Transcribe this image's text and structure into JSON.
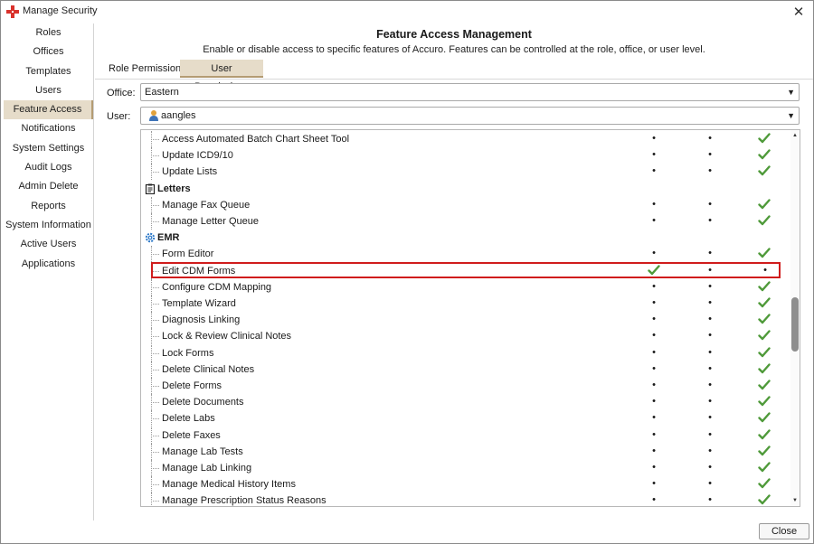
{
  "window": {
    "title": "Manage Security",
    "close_glyph": "✕"
  },
  "sidebar": {
    "items": [
      {
        "label": "Roles",
        "active": false
      },
      {
        "label": "Offices",
        "active": false
      },
      {
        "label": "Templates",
        "active": false
      },
      {
        "label": "Users",
        "active": false
      },
      {
        "label": "Feature Access",
        "active": true
      },
      {
        "label": "Notifications",
        "active": false
      },
      {
        "label": "System Settings",
        "active": false
      },
      {
        "label": "Audit Logs",
        "active": false
      },
      {
        "label": "Admin Delete",
        "active": false
      },
      {
        "label": "Reports",
        "active": false
      },
      {
        "label": "System Information",
        "active": false
      },
      {
        "label": "Active Users",
        "active": false
      },
      {
        "label": "Applications",
        "active": false
      }
    ]
  },
  "main": {
    "title": "Feature Access Management",
    "subtitle": "Enable or disable access to specific features of Accuro. Features can be controlled at the role, office, or user level.",
    "tabs": [
      {
        "label": "Role Permissions",
        "active": false
      },
      {
        "label": "User Permissions",
        "active": true
      }
    ],
    "office": {
      "label": "Office:",
      "value": "Eastern"
    },
    "user": {
      "label": "User:",
      "value": "aangles"
    }
  },
  "tree": {
    "rows": [
      {
        "type": "item",
        "label": "Access Automated Batch Chart Sheet Tool",
        "cells": [
          "dot",
          "dot",
          "check"
        ]
      },
      {
        "type": "item",
        "label": "Update ICD9/10",
        "cells": [
          "dot",
          "dot",
          "check"
        ]
      },
      {
        "type": "item",
        "label": "Update Lists",
        "cells": [
          "dot",
          "dot",
          "check"
        ]
      },
      {
        "type": "category",
        "label": "Letters",
        "icon": "clipboard-icon"
      },
      {
        "type": "item",
        "label": "Manage Fax Queue",
        "cells": [
          "dot",
          "dot",
          "check"
        ]
      },
      {
        "type": "item",
        "label": "Manage Letter Queue",
        "cells": [
          "dot",
          "dot",
          "check"
        ]
      },
      {
        "type": "category",
        "label": "EMR",
        "icon": "gear-icon"
      },
      {
        "type": "item",
        "label": "Form Editor",
        "cells": [
          "dot",
          "dot",
          "check"
        ]
      },
      {
        "type": "item",
        "label": "Edit CDM Forms",
        "cells": [
          "check",
          "dot",
          "dot"
        ],
        "highlight": true
      },
      {
        "type": "item",
        "label": "Configure CDM Mapping",
        "cells": [
          "dot",
          "dot",
          "check"
        ]
      },
      {
        "type": "item",
        "label": "Template Wizard",
        "cells": [
          "dot",
          "dot",
          "check"
        ]
      },
      {
        "type": "item",
        "label": "Diagnosis Linking",
        "cells": [
          "dot",
          "dot",
          "check"
        ]
      },
      {
        "type": "item",
        "label": "Lock & Review Clinical Notes",
        "cells": [
          "dot",
          "dot",
          "check"
        ]
      },
      {
        "type": "item",
        "label": "Lock Forms",
        "cells": [
          "dot",
          "dot",
          "check"
        ]
      },
      {
        "type": "item",
        "label": "Delete Clinical Notes",
        "cells": [
          "dot",
          "dot",
          "check"
        ]
      },
      {
        "type": "item",
        "label": "Delete Forms",
        "cells": [
          "dot",
          "dot",
          "check"
        ]
      },
      {
        "type": "item",
        "label": "Delete Documents",
        "cells": [
          "dot",
          "dot",
          "check"
        ]
      },
      {
        "type": "item",
        "label": "Delete Labs",
        "cells": [
          "dot",
          "dot",
          "check"
        ]
      },
      {
        "type": "item",
        "label": "Delete Faxes",
        "cells": [
          "dot",
          "dot",
          "check"
        ]
      },
      {
        "type": "item",
        "label": "Manage Lab Tests",
        "cells": [
          "dot",
          "dot",
          "check"
        ]
      },
      {
        "type": "item",
        "label": "Manage Lab Linking",
        "cells": [
          "dot",
          "dot",
          "check"
        ]
      },
      {
        "type": "item",
        "label": "Manage Medical History Items",
        "cells": [
          "dot",
          "dot",
          "check"
        ]
      },
      {
        "type": "item",
        "label": "Manage Prescription Status Reasons",
        "cells": [
          "dot",
          "dot",
          "check"
        ]
      }
    ],
    "scroll_position": 0.52
  },
  "footer": {
    "close_label": "Close"
  },
  "colors": {
    "accent": "#e6dcc9",
    "highlight_border": "#d01c1c",
    "check_green": "#4f9a3a"
  }
}
